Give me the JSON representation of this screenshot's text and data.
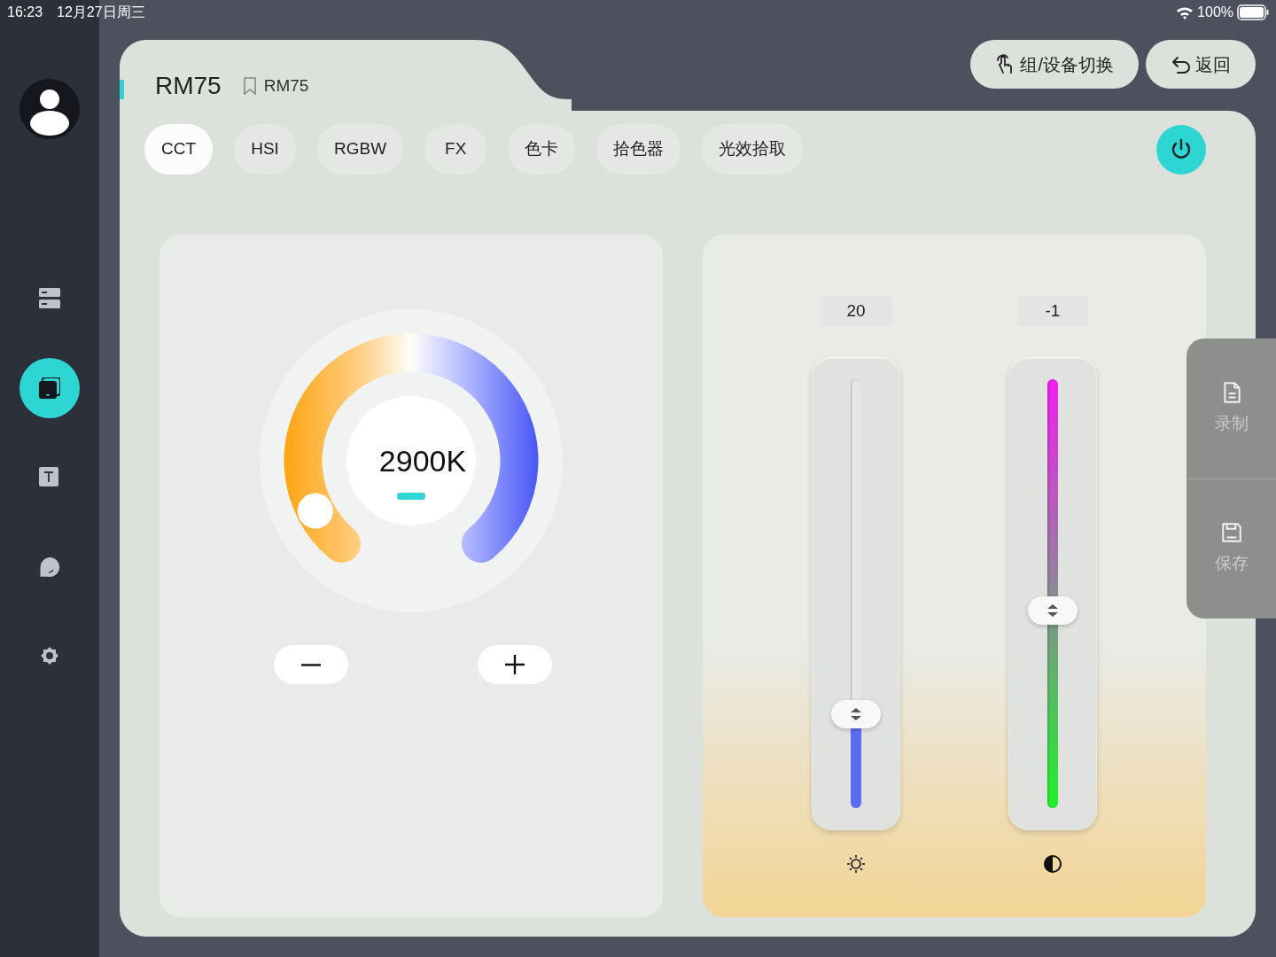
{
  "status_bar": {
    "time": "16:23",
    "date": "12月27日周三",
    "battery": "100%"
  },
  "sidebar": {
    "items": [
      {
        "kind": "list",
        "selected": false
      },
      {
        "kind": "device",
        "selected": true
      },
      {
        "kind": "text",
        "selected": false
      },
      {
        "kind": "chat",
        "selected": false
      },
      {
        "kind": "settings",
        "selected": false
      }
    ]
  },
  "header": {
    "title": "RM75",
    "tag": "RM75"
  },
  "top_buttons": [
    {
      "kind": "switch",
      "label": "组/设备切换"
    },
    {
      "kind": "back",
      "label": "返回"
    }
  ],
  "mode_tabs": [
    {
      "label": "CCT",
      "selected": true
    },
    {
      "label": "HSI",
      "selected": false
    },
    {
      "label": "RGBW",
      "selected": false
    },
    {
      "label": "FX",
      "selected": false
    },
    {
      "label": "色卡",
      "selected": false
    },
    {
      "label": "拾色器",
      "selected": false
    },
    {
      "label": "光效拾取",
      "selected": false
    }
  ],
  "power": {
    "on": true
  },
  "cct_dial": {
    "value": "2900K",
    "level": 0.08
  },
  "sliders": [
    {
      "kind": "brightness",
      "reading": "20",
      "level": 0.22
    },
    {
      "kind": "tint",
      "reading": "-1",
      "level": 0.46
    }
  ],
  "side_actions": [
    {
      "kind": "record",
      "label": "录制"
    },
    {
      "kind": "save",
      "label": "保存"
    }
  ]
}
